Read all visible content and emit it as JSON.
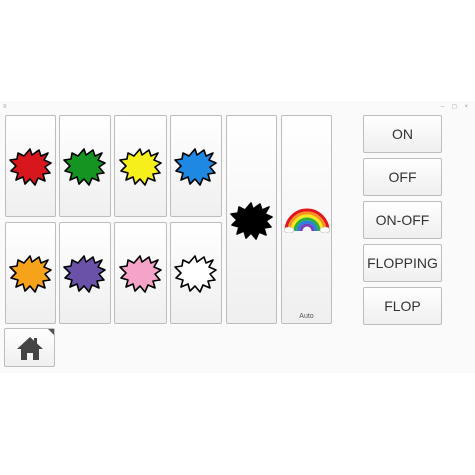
{
  "window": {
    "menu_glyph": "≡",
    "controls_glyph": "– ◻ ×"
  },
  "colors": [
    {
      "name": "red-paint-icon",
      "fill": "#d7161d"
    },
    {
      "name": "green-paint-icon",
      "fill": "#159422"
    },
    {
      "name": "yellow-paint-icon",
      "fill": "#f7ef1c"
    },
    {
      "name": "blue-paint-icon",
      "fill": "#1f88e2"
    },
    {
      "name": "orange-paint-icon",
      "fill": "#f7a21b"
    },
    {
      "name": "purple-paint-icon",
      "fill": "#6b52a9"
    },
    {
      "name": "pink-paint-icon",
      "fill": "#f5a3c7"
    },
    {
      "name": "white-paint-icon",
      "fill": "#ffffff"
    },
    {
      "name": "black-paint-icon",
      "fill": "#000000"
    }
  ],
  "auto_tile": {
    "label": "Auto",
    "icon": "rainbow-icon"
  },
  "commands": [
    "ON",
    "OFF",
    "ON-OFF",
    "FLOPPING",
    "FLOP"
  ],
  "home": {
    "icon": "home-icon"
  }
}
